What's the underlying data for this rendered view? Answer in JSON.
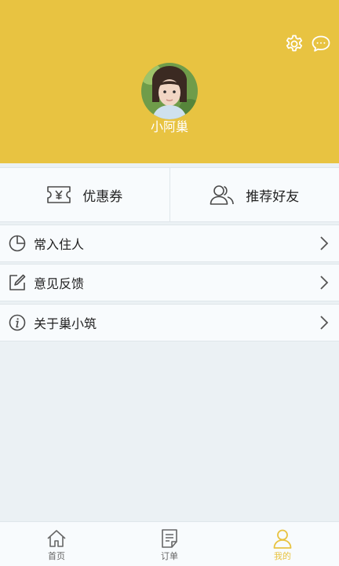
{
  "header": {
    "username": "小阿巢",
    "icons": {
      "settings": "gear-icon",
      "messages": "chat-bubble-icon"
    }
  },
  "quick_actions": [
    {
      "label": "优惠券",
      "icon": "yen-ticket-icon"
    },
    {
      "label": "推荐好友",
      "icon": "users-icon"
    }
  ],
  "menu": [
    {
      "label": "常入住人",
      "icon": "pie-chart-icon"
    },
    {
      "label": "意见反馈",
      "icon": "edit-icon"
    },
    {
      "label": "关于巢小筑",
      "icon": "info-icon"
    }
  ],
  "tabbar": {
    "tabs": [
      {
        "label": "首页",
        "icon": "home-icon"
      },
      {
        "label": "订单",
        "icon": "order-icon"
      },
      {
        "label": "我的",
        "icon": "person-icon"
      }
    ],
    "active_index": 2
  },
  "colors": {
    "accent": "#e8c341",
    "background": "#ebf1f4",
    "panel": "#f8fbfd",
    "divider": "#dfe6ea"
  }
}
